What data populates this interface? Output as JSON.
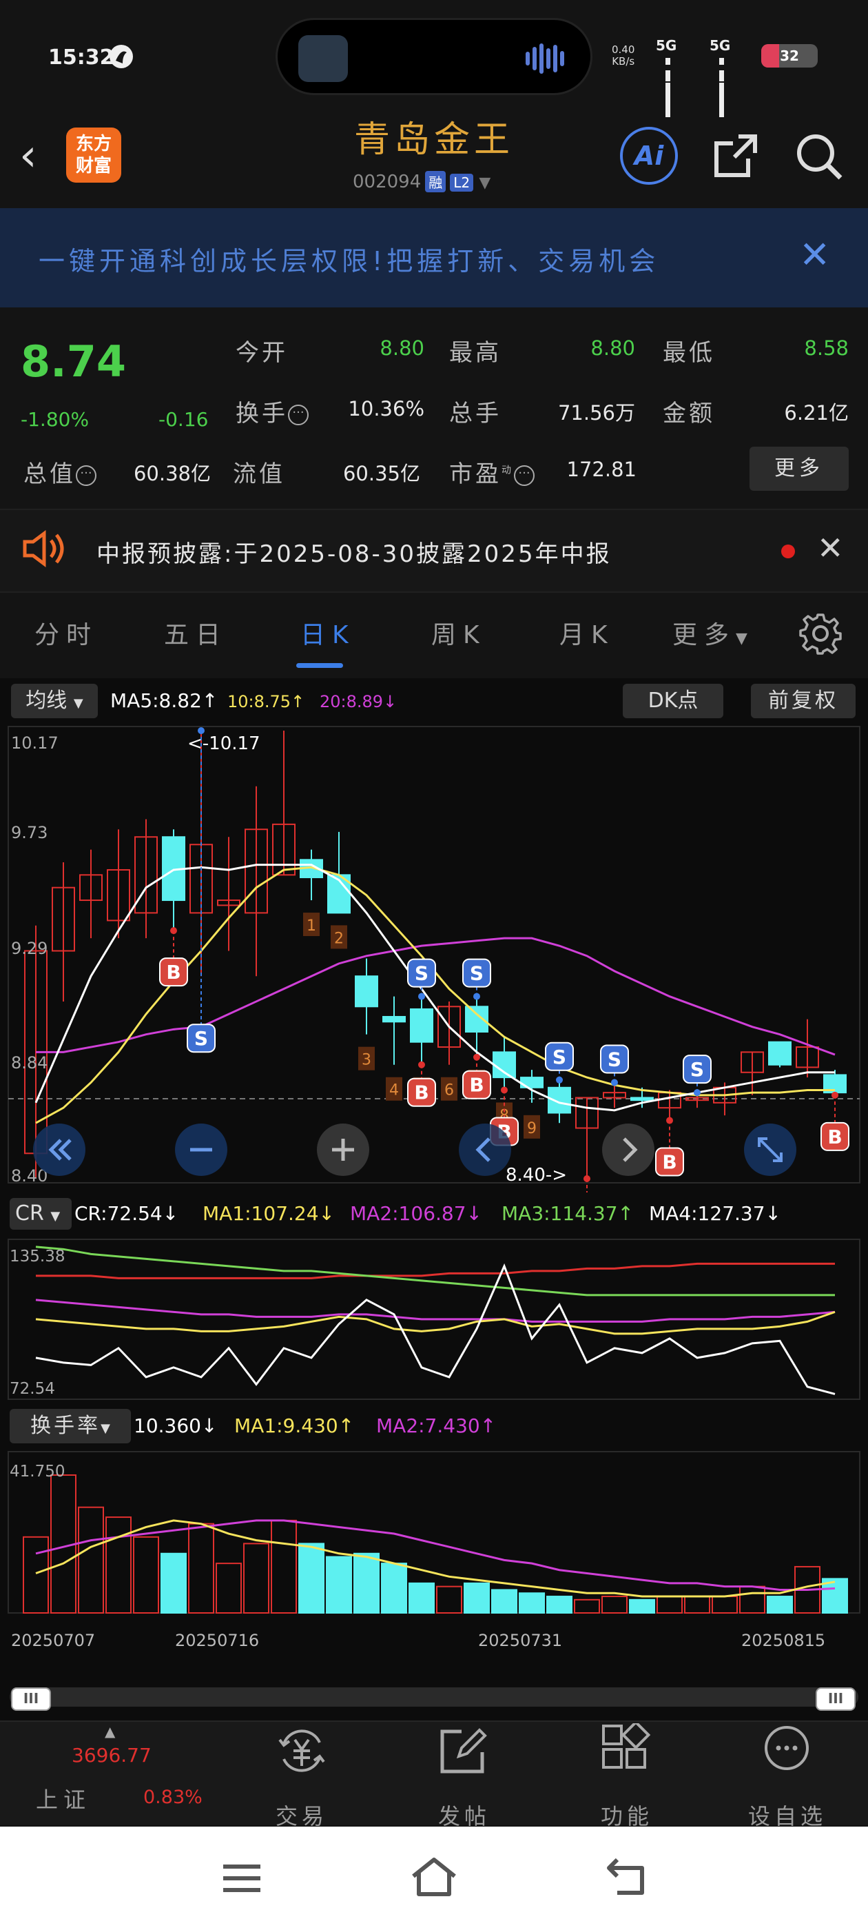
{
  "status": {
    "time": "15:32",
    "net_speed": "0.40",
    "net_unit": "KB/s",
    "sim1": "5G",
    "sim2": "5G",
    "battery": "32",
    "battery_level": 0.32
  },
  "header": {
    "logo_line1": "东方",
    "logo_line2": "财富",
    "stock_name": "青岛金王",
    "stock_code": "002094",
    "tag1": "融",
    "tag2": "L2",
    "ai_label": "Ai"
  },
  "banner": {
    "text": "一键开通科创成长层权限!把握打新、交易机会"
  },
  "quote": {
    "price": "8.74",
    "change_pct": "-1.80%",
    "change": "-0.16",
    "open_label": "今开",
    "open": "8.80",
    "high_label": "最高",
    "high": "8.80",
    "low_label": "最低",
    "low": "8.58",
    "turnover_label": "换手",
    "turnover": "10.36%",
    "volume_label": "总手",
    "volume": "71.56万",
    "amount_label": "金额",
    "amount": "6.21亿",
    "mcap_label": "总值",
    "mcap": "60.38亿",
    "float_label": "流值",
    "float_cap": "60.35亿",
    "pe_label": "市盈",
    "pe_sup": "动",
    "pe": "172.81",
    "more_label": "更多"
  },
  "notice": {
    "text": "中报预披露:于2025-08-30披露2025年中报"
  },
  "tabs": [
    {
      "label": "分时"
    },
    {
      "label": "五日"
    },
    {
      "label": "日K"
    },
    {
      "label": "周K"
    },
    {
      "label": "月K"
    },
    {
      "label": "更多"
    }
  ],
  "kline": {
    "ma_selector": "均线",
    "ma5": "MA5:8.82",
    "ma10": "10:8.75",
    "ma20": "20:8.89",
    "dk_label": "DK点",
    "adjust_label": "前复权",
    "price_max_label": "10.17",
    "price_max_note": "<-10.17",
    "price_min_note": "8.40->",
    "y_labels": [
      "10.17",
      "9.73",
      "9.29",
      "8.84",
      "8.40"
    ],
    "colors": {
      "up": "#e0302e",
      "down": "#5df0f0",
      "ma5": "#ffffff",
      "ma10": "#f6e45c",
      "ma20": "#d040d8"
    }
  },
  "cr": {
    "selector": "CR",
    "cr": "CR:72.54",
    "ma1": "MA1:107.24",
    "ma2": "MA2:106.87",
    "ma3": "MA3:114.37",
    "ma4": "MA4:127.37",
    "y_labels": [
      "135.38",
      "72.54"
    ]
  },
  "turnover_panel": {
    "selector": "换手率",
    "value": "10.360",
    "ma1": "MA1:9.430",
    "ma2": "MA2:7.430",
    "y_label": "41.750",
    "dates": [
      "20250707",
      "20250716",
      "20250731",
      "20250815"
    ]
  },
  "chart_data": {
    "type": "candlestick",
    "ylim": [
      8.4,
      10.17
    ],
    "candles": [
      {
        "o": 8.5,
        "h": 9.4,
        "l": 8.4,
        "c": 9.3
      },
      {
        "o": 9.3,
        "h": 9.65,
        "l": 9.1,
        "c": 9.55
      },
      {
        "o": 9.5,
        "h": 9.7,
        "l": 9.35,
        "c": 9.6
      },
      {
        "o": 9.42,
        "h": 9.78,
        "l": 9.35,
        "c": 9.62
      },
      {
        "o": 9.45,
        "h": 9.82,
        "l": 9.35,
        "c": 9.75
      },
      {
        "o": 9.75,
        "h": 9.78,
        "l": 9.38,
        "c": 9.5
      },
      {
        "o": 9.45,
        "h": 10.17,
        "l": 9.2,
        "c": 9.72
      },
      {
        "o": 9.48,
        "h": 9.75,
        "l": 9.3,
        "c": 9.5
      },
      {
        "o": 9.45,
        "h": 9.95,
        "l": 9.2,
        "c": 9.78
      },
      {
        "o": 9.6,
        "h": 10.17,
        "l": 9.6,
        "c": 9.8
      },
      {
        "o": 9.66,
        "h": 9.7,
        "l": 9.5,
        "c": 9.59
      },
      {
        "o": 9.6,
        "h": 9.77,
        "l": 9.45,
        "c": 9.45
      },
      {
        "o": 9.2,
        "h": 9.27,
        "l": 8.97,
        "c": 9.08
      },
      {
        "o": 9.04,
        "h": 9.12,
        "l": 8.85,
        "c": 9.02
      },
      {
        "o": 9.07,
        "h": 9.12,
        "l": 8.85,
        "c": 8.94
      },
      {
        "o": 8.92,
        "h": 9.1,
        "l": 8.85,
        "c": 9.08
      },
      {
        "o": 9.08,
        "h": 9.12,
        "l": 8.88,
        "c": 8.98
      },
      {
        "o": 8.9,
        "h": 8.96,
        "l": 8.75,
        "c": 8.8
      },
      {
        "o": 8.8,
        "h": 8.83,
        "l": 8.7,
        "c": 8.76
      },
      {
        "o": 8.76,
        "h": 8.79,
        "l": 8.62,
        "c": 8.66
      },
      {
        "o": 8.6,
        "h": 8.72,
        "l": 8.4,
        "c": 8.72
      },
      {
        "o": 8.72,
        "h": 8.78,
        "l": 8.68,
        "c": 8.74
      },
      {
        "o": 8.72,
        "h": 8.76,
        "l": 8.68,
        "c": 8.71
      },
      {
        "o": 8.68,
        "h": 8.75,
        "l": 8.63,
        "c": 8.74
      },
      {
        "o": 8.71,
        "h": 8.74,
        "l": 8.68,
        "c": 8.72
      },
      {
        "o": 8.7,
        "h": 8.78,
        "l": 8.65,
        "c": 8.76
      },
      {
        "o": 8.82,
        "h": 8.9,
        "l": 8.73,
        "c": 8.9
      },
      {
        "o": 8.94,
        "h": 8.94,
        "l": 8.84,
        "c": 8.85
      },
      {
        "o": 8.84,
        "h": 9.03,
        "l": 8.8,
        "c": 8.92
      },
      {
        "o": 8.81,
        "h": 8.83,
        "l": 8.73,
        "c": 8.74
      }
    ],
    "ma5": [
      8.7,
      8.95,
      9.2,
      9.38,
      9.55,
      9.62,
      9.63,
      9.62,
      9.64,
      9.64,
      9.64,
      9.58,
      9.45,
      9.3,
      9.15,
      9.0,
      8.9,
      8.82,
      8.75,
      8.7,
      8.68,
      8.67,
      8.7,
      8.72,
      8.74,
      8.76,
      8.78,
      8.8,
      8.82,
      8.82
    ],
    "ma10": [
      8.62,
      8.68,
      8.78,
      8.9,
      9.05,
      9.18,
      9.3,
      9.43,
      9.55,
      9.62,
      9.63,
      9.6,
      9.52,
      9.4,
      9.28,
      9.15,
      9.05,
      8.96,
      8.9,
      8.84,
      8.8,
      8.77,
      8.75,
      8.74,
      8.73,
      8.73,
      8.74,
      8.74,
      8.75,
      8.75
    ],
    "ma20": [
      8.9,
      8.9,
      8.92,
      8.94,
      8.97,
      8.99,
      9.0,
      9.05,
      9.1,
      9.15,
      9.2,
      9.25,
      9.28,
      9.3,
      9.32,
      9.33,
      9.34,
      9.35,
      9.35,
      9.32,
      9.28,
      9.22,
      9.17,
      9.12,
      9.08,
      9.04,
      9.0,
      8.97,
      8.93,
      8.89
    ],
    "signals": [
      {
        "i": 5,
        "type": "B"
      },
      {
        "i": 6,
        "type": "S"
      },
      {
        "i": 14,
        "type": "S"
      },
      {
        "i": 16,
        "type": "S"
      },
      {
        "i": 14,
        "type": "B",
        "low": true
      },
      {
        "i": 17,
        "type": "B"
      },
      {
        "i": 16,
        "type": "B",
        "low": true
      },
      {
        "i": 19,
        "type": "S"
      },
      {
        "i": 20,
        "type": "B"
      },
      {
        "i": 21,
        "type": "S"
      },
      {
        "i": 23,
        "type": "B"
      },
      {
        "i": 24,
        "type": "S"
      },
      {
        "i": 29,
        "type": "B"
      }
    ],
    "counts": [
      {
        "i": 10,
        "n": "1"
      },
      {
        "i": 11,
        "n": "2"
      },
      {
        "i": 12,
        "n": "3"
      },
      {
        "i": 13,
        "n": "4"
      },
      {
        "i": 14,
        "n": "5"
      },
      {
        "i": 15,
        "n": "6"
      },
      {
        "i": 16,
        "n": "7"
      },
      {
        "i": 17,
        "n": "8"
      },
      {
        "i": 18,
        "n": "9"
      }
    ],
    "cr_series": {
      "cr": [
        88,
        86,
        85,
        92,
        80,
        84,
        80,
        92,
        77,
        92,
        88,
        102,
        112,
        106,
        84,
        80,
        100,
        126,
        96,
        110,
        86,
        92,
        90,
        96,
        88,
        90,
        94,
        95,
        76,
        73
      ],
      "ma1": [
        104,
        103,
        102,
        101,
        100,
        100,
        99,
        99,
        100,
        101,
        103,
        105,
        104,
        100,
        99,
        100,
        103,
        104,
        101,
        102,
        100,
        98,
        98,
        99,
        100,
        100,
        100,
        101,
        103,
        107
      ],
      "ma2": [
        112,
        111,
        110,
        109,
        108,
        107,
        106,
        106,
        105,
        105,
        105,
        106,
        106,
        105,
        104,
        104,
        104,
        104,
        103,
        103,
        103,
        103,
        103,
        104,
        104,
        104,
        105,
        105,
        106,
        107
      ],
      "ma3": [
        134,
        133,
        131,
        130,
        129,
        128,
        127,
        126,
        125,
        124,
        124,
        123,
        122,
        121,
        120,
        119,
        118,
        117,
        116,
        115,
        114,
        114,
        114,
        114,
        114,
        114,
        114,
        114,
        114,
        114
      ],
      "ma4": [
        122,
        122,
        122,
        121,
        121,
        121,
        121,
        121,
        121,
        121,
        121,
        122,
        122,
        122,
        122,
        123,
        123,
        123,
        124,
        124,
        125,
        125,
        126,
        126,
        127,
        127,
        127,
        127,
        127,
        127
      ]
    },
    "turnover": [
      23,
      41.75,
      32,
      29,
      23,
      18,
      27,
      15,
      21,
      28,
      21,
      17,
      18,
      15,
      9,
      8,
      9,
      7,
      6,
      5,
      4,
      5,
      4,
      5,
      5,
      5,
      8,
      5,
      14,
      10.36
    ],
    "turnover_ma1": [
      12,
      15,
      20,
      23,
      26,
      28,
      27,
      24,
      22,
      21,
      20,
      18,
      17,
      15,
      13,
      11,
      10,
      9,
      8,
      7,
      6,
      6,
      5,
      5,
      5,
      5,
      6,
      6,
      8,
      9.43
    ],
    "turnover_ma2": [
      18,
      20,
      22,
      23,
      24,
      25,
      26,
      27,
      28,
      28,
      27,
      26,
      25,
      24,
      22,
      20,
      18,
      16,
      15,
      13,
      12,
      11,
      10,
      9,
      9,
      8,
      8,
      7,
      7,
      7.43
    ]
  },
  "scroll": {
    "handle": "III"
  },
  "dock": {
    "index_value": "3696.77",
    "index_name": "上证",
    "index_pct": "0.83%",
    "items": [
      {
        "label": "交易"
      },
      {
        "label": "发帖"
      },
      {
        "label": "功能"
      },
      {
        "label": "设自选"
      }
    ]
  }
}
